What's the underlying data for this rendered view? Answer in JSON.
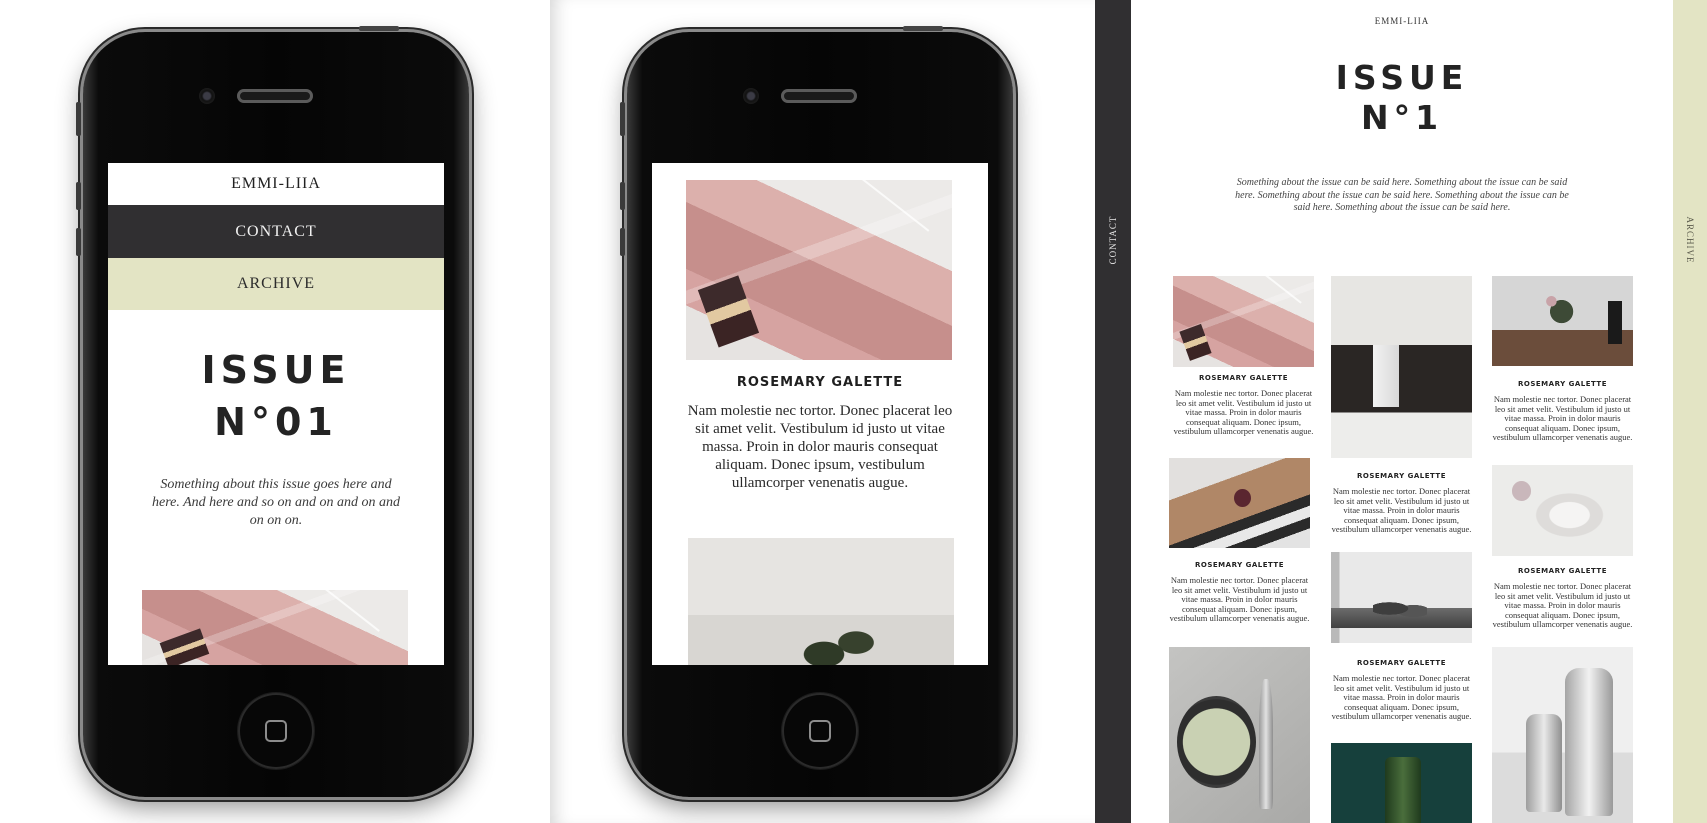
{
  "brand": "EMMI-LIIA",
  "nav": {
    "brand": "EMMI-LIIA",
    "contact": "CONTACT",
    "archive": "ARCHIVE"
  },
  "issue": {
    "line1": "ISSUE",
    "line2_mobile": "N°01",
    "line2_desktop": "N°1",
    "intro_mobile": "Something about this issue goes here and here. And here and so on and on and on and on on on.",
    "intro_desktop": "Something about the issue can be said here. Something about the issue can be said here. Something about the issue can be said here. Something about the issue can be said here. Something about the issue can be said here."
  },
  "post": {
    "title": "ROSEMARY GALETTE",
    "body": "Nam molestie nec tortor. Donec placerat leo sit amet velit. Vestibulum id justo ut vitae massa. Proin in dolor mauris consequat aliquam. Donec ipsum, vestibulum ullamcorper venenatis augue."
  },
  "cards": [
    {
      "title": "ROSEMARY GALETTE",
      "text": "Nam molestie nec tortor. Donec placerat leo sit amet velit. Vestibulum id justo ut vitae massa. Proin in dolor mauris consequat aliquam. Donec ipsum, vestibulum ullamcorper venenatis augue."
    },
    {
      "title": "ROSEMARY GALETTE",
      "text": "Nam molestie nec tortor. Donec placerat leo sit amet velit. Vestibulum id justo ut vitae massa. Proin in dolor mauris consequat aliquam. Donec ipsum, vestibulum ullamcorper venenatis augue."
    },
    {
      "title": "ROSEMARY GALETTE",
      "text": "Nam molestie nec tortor. Donec placerat leo sit amet velit. Vestibulum id justo ut vitae massa. Proin in dolor mauris consequat aliquam. Donec ipsum, vestibulum ullamcorper venenatis augue."
    },
    {
      "title": "ROSEMARY GALETTE",
      "text": "Nam molestie nec tortor. Donec placerat leo sit amet velit. Vestibulum id justo ut vitae massa. Proin in dolor mauris consequat aliquam. Donec ipsum, vestibulum ullamcorper venenatis augue."
    },
    {
      "title": "ROSEMARY GALETTE",
      "text": "Nam molestie nec tortor. Donec placerat leo sit amet velit. Vestibulum id justo ut vitae massa. Proin in dolor mauris consequat aliquam. Donec ipsum, vestibulum ullamcorper venenatis augue."
    },
    {
      "title": "ROSEMARY GALETTE",
      "text": "Nam molestie nec tortor. Donec placerat leo sit amet velit. Vestibulum id justo ut vitae massa. Proin in dolor mauris consequat aliquam. Donec ipsum, vestibulum ullamcorper venenatis augue."
    }
  ],
  "colors": {
    "contact_bg": "#302f31",
    "archive_bg": "#e3e4c4",
    "text_dark": "#232323"
  }
}
